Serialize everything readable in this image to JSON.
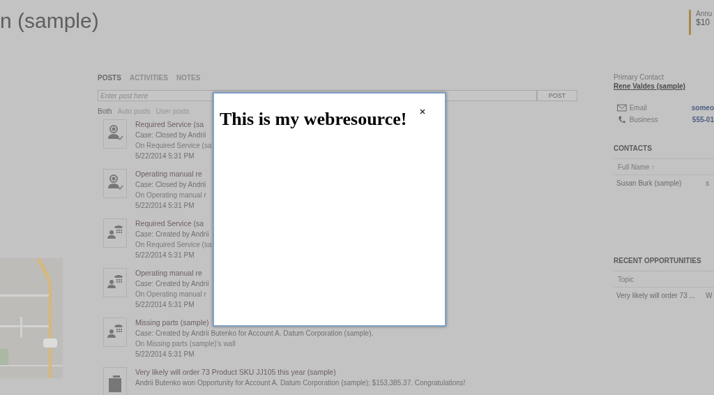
{
  "header": {
    "title": "n (sample)",
    "stat_label": "Annu",
    "stat_value": "$10"
  },
  "tabs": [
    {
      "label": "POSTS",
      "selected": true
    },
    {
      "label": "ACTIVITIES",
      "selected": false
    },
    {
      "label": "NOTES",
      "selected": false
    }
  ],
  "post_box": {
    "placeholder": "Enter post here",
    "button": "POST"
  },
  "filters": [
    {
      "label": "Both",
      "selected": true
    },
    {
      "label": "Auto posts",
      "selected": false
    },
    {
      "label": "User posts",
      "selected": false
    }
  ],
  "posts": [
    {
      "kind": "closed",
      "title": "Required Service (sa",
      "detail": "Case: Closed by Andrii",
      "wall": "On Required Service (sa",
      "time": "5/22/2014 5:31 PM"
    },
    {
      "kind": "closed",
      "title": "Operating manual re",
      "detail": "Case: Closed by Andrii",
      "wall": "On Operating manual r",
      "time": "5/22/2014 5:31 PM"
    },
    {
      "kind": "created",
      "title": "Required Service (sa",
      "detail": "Case: Created by Andrii",
      "wall": "On Required Service (sa",
      "time": "5/22/2014 5:31 PM"
    },
    {
      "kind": "created",
      "title": "Operating manual re",
      "detail": "Case: Created by Andrii",
      "wall": "On Operating manual r",
      "time": "5/22/2014 5:31 PM"
    },
    {
      "kind": "created",
      "title": "Missing parts (sample)",
      "detail": "Case: Created by Andrii Butenko for Account A. Datum Corporation (sample).",
      "wall": "On Missing parts (sample)'s wall",
      "time": "5/22/2014 5:31 PM"
    },
    {
      "kind": "won",
      "title": "Very likely will order 73 Product SKU JJ105 this year (sample)",
      "detail": "Andrii Butenko won Opportunity for Account A. Datum Corporation (sample); $153,385.37. Congratulations!"
    }
  ],
  "primary_contact": {
    "label": "Primary Contact",
    "name": "Rene Valdes (sample)",
    "rows": [
      {
        "kind": "email",
        "label": "Email",
        "value": "someo"
      },
      {
        "kind": "phone",
        "label": "Business",
        "value": "555-01"
      }
    ]
  },
  "contacts": {
    "title": "CONTACTS",
    "columns": [
      "Full Name ↑"
    ],
    "rows": [
      [
        "Susan Burk (sample)",
        "s"
      ]
    ]
  },
  "opportunities": {
    "title": "RECENT OPPORTUNITIES",
    "columns": [
      "Topic"
    ],
    "rows": [
      [
        "Very likely will order 73 ...",
        "W"
      ]
    ]
  },
  "dialog": {
    "heading": "This is my webresource!"
  }
}
